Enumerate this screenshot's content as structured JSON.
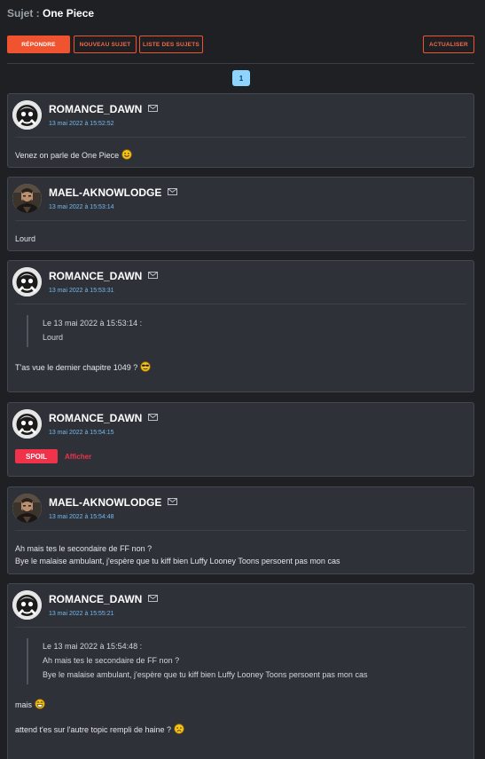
{
  "topic": {
    "prefix": "Sujet :",
    "name": "One Piece"
  },
  "toolbar": {
    "reply_label": "RÉPONDRE",
    "new_topic_label": "NOUVEAU SUJET",
    "topic_list_label": "LISTE DES SUJETS",
    "refresh_label": "ACTUALISER"
  },
  "pagination": {
    "current": "1"
  },
  "colors": {
    "accent": "#f0532f",
    "spoil": "#f0324a",
    "date": "#75b9ef",
    "page_active": "#8fd4ff"
  },
  "posts": [
    {
      "author": "ROMANCE_DAWN",
      "date": "13 mai 2022 à 15:52:52",
      "text": "Venez on parle de One Piece",
      "smiley": "smile-icon"
    },
    {
      "author": "MAEL-AKNOWLODGE",
      "date": "13 mai 2022 à 15:53:14",
      "text": "Lourd"
    },
    {
      "author": "ROMANCE_DAWN",
      "date": "13 mai 2022 à 15:53:31",
      "quote": {
        "header": "Le 13 mai 2022 à 15:53:14 :",
        "lines": [
          "Lourd"
        ]
      },
      "text": "T'as vue le dernier chapitre 1049 ?",
      "smiley": "sunglasses-icon"
    },
    {
      "author": "ROMANCE_DAWN",
      "date": "13 mai 2022 à 15:54:15",
      "spoil_label": "SPOIL",
      "spoil_action": "Afficher"
    },
    {
      "author": "MAEL-AKNOWLODGE",
      "date": "13 mai 2022 à 15:54:48",
      "lines": [
        "Ah mais tes le secondaire de FF non ?",
        "Bye le malaise ambulant, j'espère que tu kiff bien Luffy Looney Toons persoent pas mon cas"
      ]
    },
    {
      "author": "ROMANCE_DAWN",
      "date": "13 mai 2022 à 15:55:21",
      "quote": {
        "header": "Le 13 mai 2022 à 15:54:48 :",
        "lines": [
          "Ah mais tes le secondaire de FF non ?",
          "Bye le malaise ambulant, j'espère que tu kiff bien Luffy Looney Toons persoent pas mon cas"
        ]
      },
      "text": "mais",
      "smiley": "grin-icon",
      "text2": "attend t'es sur l'autre topic rempli de haine ?",
      "smiley2": "worried-icon"
    }
  ]
}
